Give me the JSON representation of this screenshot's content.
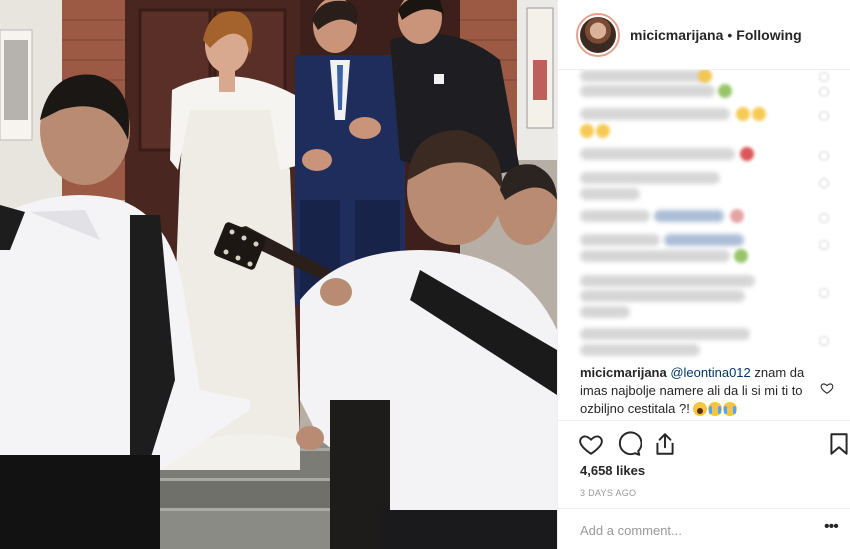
{
  "post": {
    "username": "micicmarijana",
    "separator": "•",
    "follow_state": "Following"
  },
  "caption": {
    "username": "micicmarijana",
    "mention": "@leontina012",
    "text": "znam da imas najbolje namere ali da li si mi ti to ozbiljno cestitala ?!",
    "emojis": [
      "face-screaming-icon",
      "loudly-crying-icon",
      "loudly-crying-icon"
    ]
  },
  "stats": {
    "likes": "4,658 likes",
    "date": "3 DAYS AGO"
  },
  "comment_box": {
    "placeholder": "Add a comment...",
    "more": "•••"
  },
  "icons": [
    "heart-icon",
    "comment-icon",
    "share-icon",
    "bookmark-icon",
    "more-options-icon"
  ],
  "colors": {
    "avatar_ring": "#e8a08c",
    "mention": "#003569",
    "muted": "#999999",
    "text": "#262626"
  }
}
